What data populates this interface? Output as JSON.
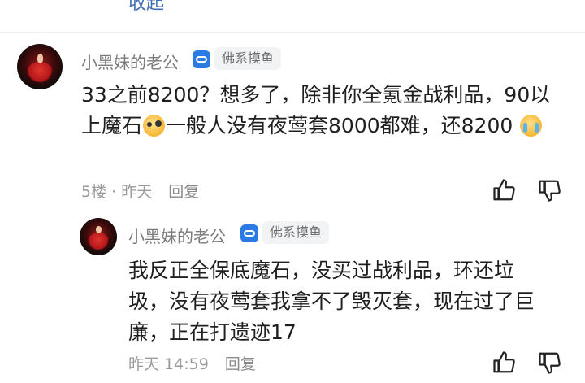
{
  "previous_reply_link": "收起",
  "comments": [
    {
      "user": "小黑妹的老公",
      "badge_icon": "game-controller-icon",
      "tag": "佛系摸鱼",
      "content_part1": "33之前8200？想多了，除非你全氪金战利品，90以上魔石",
      "emoji1": "crazy-face-emoji",
      "content_part2": "一般人没有夜莺套8000都难，还8200",
      "emoji2": "crying-face-emoji",
      "floor": "5楼",
      "separator": "·",
      "time": "昨天",
      "reply_label": "回复"
    },
    {
      "user": "小黑妹的老公",
      "badge_icon": "game-controller-icon",
      "tag": "佛系摸鱼",
      "content": "我反正全保底魔石，没买过战利品，环还垃圾，没有夜莺套我拿不了毁灭套，现在过了巨廉，正在打遗迹17",
      "time": "昨天 14:59",
      "reply_label": "回复"
    }
  ],
  "icons": {
    "like": "thumbs-up-icon",
    "dislike": "thumbs-down-icon"
  },
  "colors": {
    "link": "#3f6fb5",
    "badge": "#2c7be5",
    "meta": "#9a9a9a",
    "text": "#1f1f1f"
  }
}
